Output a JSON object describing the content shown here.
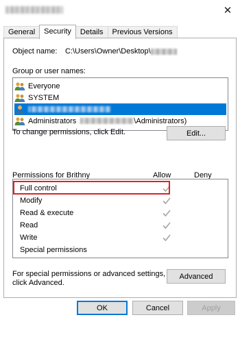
{
  "window": {
    "close_glyph": "✕"
  },
  "tabs": [
    "General",
    "Security",
    "Details",
    "Previous Versions"
  ],
  "object": {
    "label": "Object name:",
    "path": "C:\\Users\\Owner\\Desktop\\"
  },
  "groups": {
    "label": "Group or user names:",
    "items": [
      {
        "name": "Everyone",
        "icon": "users-icon"
      },
      {
        "name": "SYSTEM",
        "icon": "users-icon"
      },
      {
        "name": "",
        "icon": "user-icon",
        "selected": true
      },
      {
        "name_prefix": "Administrators",
        "name_suffix": "\\Administrators)",
        "icon": "users-icon"
      }
    ]
  },
  "change_text": "To change permissions, click Edit.",
  "edit_button": "Edit...",
  "permissions": {
    "header": "Permissions for Brithny",
    "allow_header": "Allow",
    "deny_header": "Deny",
    "rows": [
      {
        "name": "Full control",
        "allow": true
      },
      {
        "name": "Modify",
        "allow": true
      },
      {
        "name": "Read & execute",
        "allow": true
      },
      {
        "name": "Read",
        "allow": true
      },
      {
        "name": "Write",
        "allow": true
      },
      {
        "name": "Special permissions",
        "allow": false
      }
    ]
  },
  "advanced_text_1": "For special permissions or advanced settings,",
  "advanced_text_2": "click Advanced.",
  "advanced_button": "Advanced",
  "footer": {
    "ok": "OK",
    "cancel": "Cancel",
    "apply": "Apply"
  },
  "colors": {
    "selection": "#0078d7",
    "highlight": "#e02020",
    "check": "#a6a6a6"
  }
}
